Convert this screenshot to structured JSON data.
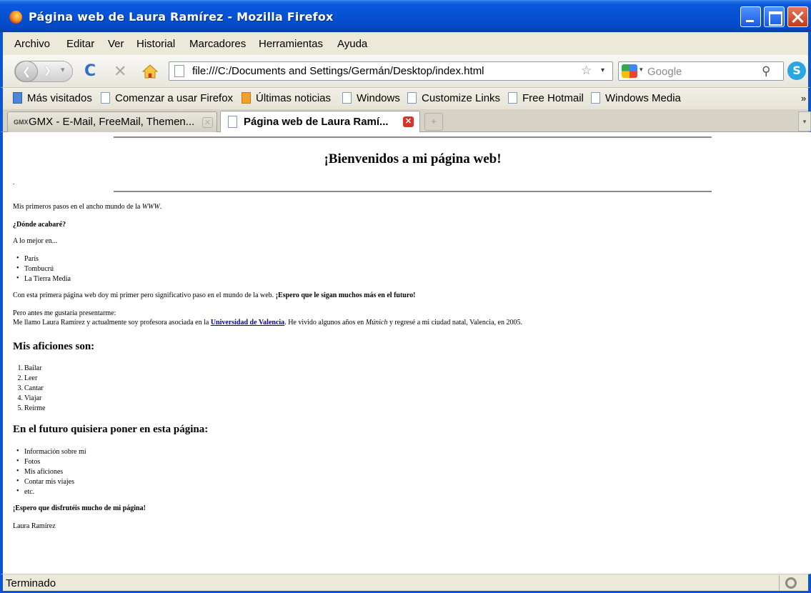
{
  "window": {
    "title": "Página web de Laura Ramírez - Mozilla Firefox"
  },
  "menu": [
    "Archivo",
    "Editar",
    "Ver",
    "Historial",
    "Marcadores",
    "Herramientas",
    "Ayuda"
  ],
  "navigation": {
    "url": "file:///C:/Documents and Settings/Germán/Desktop/index.html",
    "search_placeholder": "Google"
  },
  "bookmarks": [
    "Más visitados",
    "Comenzar a usar Firefox",
    "Últimas noticias",
    "Windows",
    "Customize Links",
    "Free Hotmail",
    "Windows Media"
  ],
  "tabs": [
    {
      "label": "GMX - E-Mail, FreeMail, Themen...",
      "active": false,
      "icon": "gmx-icon",
      "icon_text": "GMX"
    },
    {
      "label": "Página web de Laura Ramí...",
      "active": true,
      "icon": "page-icon"
    }
  ],
  "page": {
    "heading": "¡Bienvenidos a mi página web!",
    "dot": ".",
    "intro": "Mis primeros pasos en el ancho mundo de la ",
    "intro_em": "WWW",
    "intro_end": ".",
    "question": "¿Dónde acabaré?",
    "maybe": "A lo mejor en...",
    "places": [
      "París",
      "Tombucrú",
      "La Tierra Media"
    ],
    "first_page": "Con esta primera página web doy mi primer pero significativo paso en el mundo de la web. ",
    "first_page_bold": "¡Espero que le sigan muchos más en el futuro!",
    "present": "Pero antes me gustaría presentarme:",
    "bio_1": "Me llamo Laura Ramírez y actualmente soy profesora asociada en la ",
    "bio_link": "Universidad de Valencia",
    "bio_2": ". He vivido algunos años en ",
    "bio_em": "Múnich",
    "bio_3": " y regresé a mi ciudad natal, Valencia, en 2005.",
    "hobbies_title": "Mis aficiones son:",
    "hobbies": [
      "Bailar",
      "Leer",
      "Cantar",
      "Viajar",
      "Reírme"
    ],
    "future_title": "En el futuro quisiera poner en esta página:",
    "future": [
      "Información sobre mí",
      "Fotos",
      "Mis aficiones",
      "Contar mis viajes",
      "etc."
    ],
    "closing": "¡Espero que disfrutéis mucho de mi página!",
    "signature": "Laura Ramírez"
  },
  "status": "Terminado"
}
